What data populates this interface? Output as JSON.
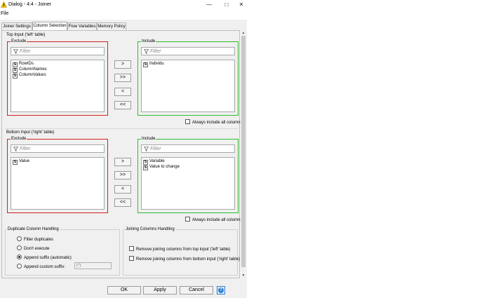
{
  "window": {
    "title": "Dialog - 4:4 - Joiner",
    "icon": "warning-icon",
    "controls": [
      "minimize-icon",
      "maximize-icon",
      "close-icon"
    ]
  },
  "menu": {
    "file": "File"
  },
  "tabs": [
    {
      "label": "Joiner Settings",
      "active": false
    },
    {
      "label": "Column Selection",
      "active": true
    },
    {
      "label": "Flow Variables",
      "active": false
    },
    {
      "label": "Memory Policy",
      "active": false
    }
  ],
  "top_input": {
    "title": "Top Input ('left' table)",
    "exclude": {
      "label": "Exclude",
      "filter_placeholder": "Filter",
      "items": [
        {
          "type": "S",
          "name": "RowIDs"
        },
        {
          "type": "S",
          "name": "ColumnNames"
        },
        {
          "type": "S",
          "name": "ColumnValues"
        }
      ]
    },
    "include": {
      "label": "Include",
      "filter_placeholder": "Filter",
      "items": [
        {
          "type": "S",
          "name": "Individu"
        }
      ]
    },
    "always_include": "Always include all columns"
  },
  "bottom_input": {
    "title": "Bottom Input ('right' table)",
    "exclude": {
      "label": "Exclude",
      "filter_placeholder": "Filter",
      "items": [
        {
          "type": "S",
          "name": "Value"
        }
      ]
    },
    "include": {
      "label": "Include",
      "filter_placeholder": "Filter",
      "items": [
        {
          "type": "S",
          "name": "Variable"
        },
        {
          "type": "S",
          "name": "Value to change"
        }
      ]
    },
    "always_include": "Always include all columns"
  },
  "move_buttons": [
    ">",
    ">>",
    "<",
    "<<"
  ],
  "duplicate_handling": {
    "title": "Duplicate Column Handling",
    "options": [
      {
        "label": "Filter duplicates",
        "selected": false
      },
      {
        "label": "Don't execute",
        "selected": false
      },
      {
        "label": "Append suffix (automatic)",
        "selected": true
      },
      {
        "label": "Append custom suffix:",
        "selected": false
      }
    ],
    "custom_suffix_value": "(*)"
  },
  "joining_handling": {
    "title": "Joining Columns Handling",
    "options": [
      {
        "label": "Remove joining columns from top input ('left' table)",
        "checked": false
      },
      {
        "label": "Remove joining columns from bottom input ('right' table)",
        "checked": false
      }
    ]
  },
  "footer": {
    "ok": "OK",
    "apply": "Apply",
    "cancel": "Cancel",
    "help_icon": "help-icon"
  },
  "colors": {
    "exclude_border": "#d42020",
    "include_border": "#2dbf2d",
    "dialog_bg": "#f0f0f0",
    "help_accent": "#2d7fd1"
  }
}
